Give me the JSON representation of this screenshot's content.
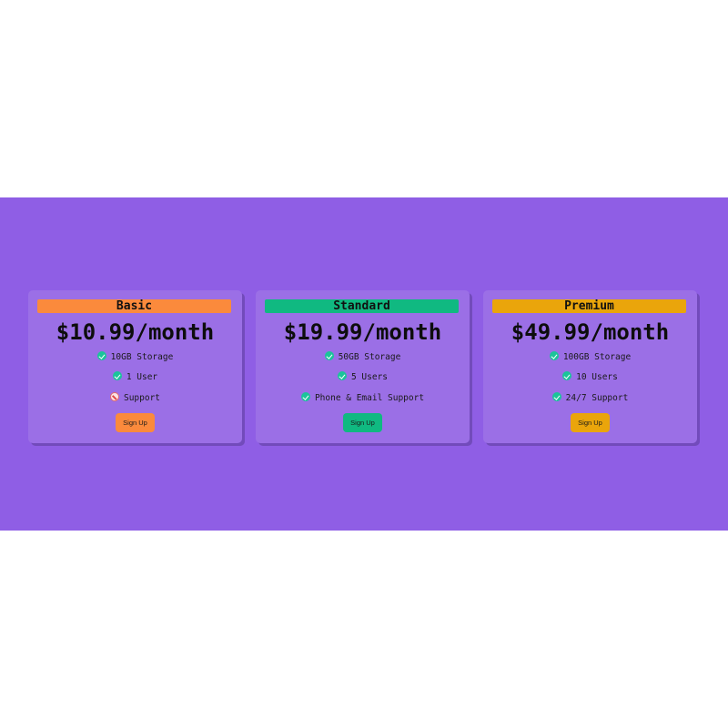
{
  "plans": [
    {
      "name": "Basic",
      "price": "$10.99/month",
      "accent": "#fb8a3c",
      "features": [
        {
          "text": "10GB Storage",
          "icon": "check-icon"
        },
        {
          "text": "1 User",
          "icon": "check-icon"
        },
        {
          "text": "Support",
          "icon": "cross-icon"
        }
      ],
      "cta": "Sign Up"
    },
    {
      "name": "Standard",
      "price": "$19.99/month",
      "accent": "#10b981",
      "features": [
        {
          "text": "50GB Storage",
          "icon": "check-icon"
        },
        {
          "text": "5 Users",
          "icon": "check-icon"
        },
        {
          "text": "Phone & Email Support",
          "icon": "check-icon"
        }
      ],
      "cta": "Sign Up"
    },
    {
      "name": "Premium",
      "price": "$49.99/month",
      "accent": "#eaa50b",
      "features": [
        {
          "text": "100GB Storage",
          "icon": "check-icon"
        },
        {
          "text": "10 Users",
          "icon": "check-icon"
        },
        {
          "text": "24/7 Support",
          "icon": "check-icon"
        }
      ],
      "cta": "Sign Up"
    }
  ],
  "colors": {
    "band_background": "#8f5ee5",
    "card_background": "#9b6fe6",
    "check": "#1bc49a",
    "cross": "#e04848"
  }
}
